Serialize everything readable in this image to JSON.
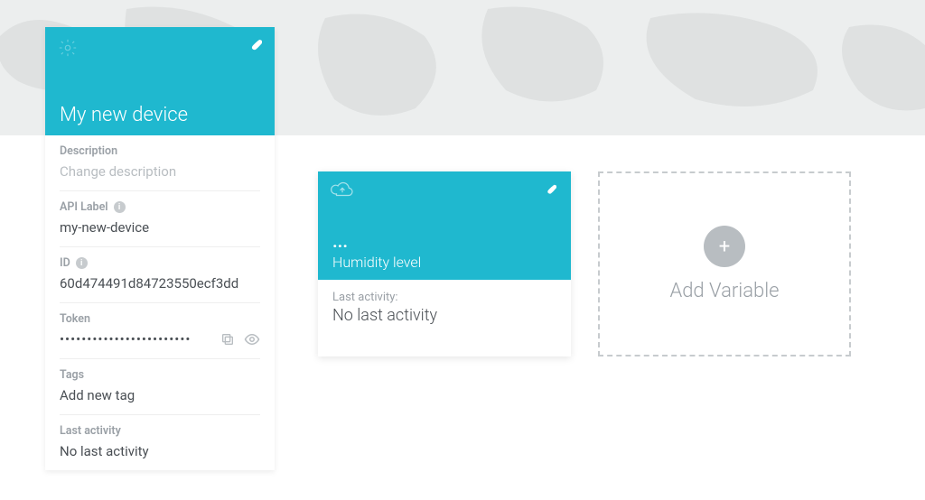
{
  "device": {
    "title": "My new device",
    "description": {
      "label": "Description",
      "placeholder": "Change description"
    },
    "api_label": {
      "label": "API Label",
      "value": "my-new-device"
    },
    "id": {
      "label": "ID",
      "value": "60d474491d84723550ecf3dd"
    },
    "token": {
      "label": "Token",
      "masked": "••••••••••••••••••••••••"
    },
    "tags": {
      "label": "Tags",
      "placeholder": "Add new tag"
    },
    "last_activity": {
      "label": "Last activity",
      "value": "No last activity"
    }
  },
  "variables": [
    {
      "value": "...",
      "name": "Humidity level",
      "last_activity_label": "Last activity:",
      "last_activity_value": "No last activity"
    }
  ],
  "add_variable_label": "Add Variable",
  "colors": {
    "accent": "#1fb8cf"
  }
}
